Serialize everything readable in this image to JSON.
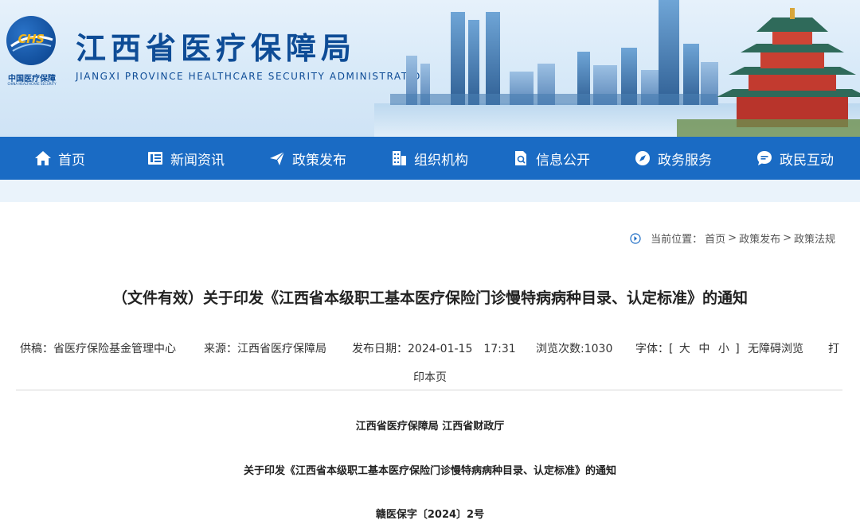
{
  "header": {
    "logo_mark": "CHS",
    "logo_cn": "中国医疗保障",
    "logo_en": "CHINA HEALTHCARE SECURITY",
    "title": "江西省医疗保障局",
    "subtitle": "JIANGXI PROVINCE HEALTHCARE SECURITY ADMINISTRATION"
  },
  "nav": {
    "items": [
      {
        "label": "首页",
        "icon": "home-icon"
      },
      {
        "label": "新闻资讯",
        "icon": "news-icon"
      },
      {
        "label": "政策发布",
        "icon": "paper-plane-icon"
      },
      {
        "label": "组织机构",
        "icon": "building-icon"
      },
      {
        "label": "信息公开",
        "icon": "document-search-icon"
      },
      {
        "label": "政务服务",
        "icon": "compass-icon"
      },
      {
        "label": "政民互动",
        "icon": "chat-icon"
      }
    ]
  },
  "breadcrumb": {
    "prefix": "当前位置：",
    "items": [
      "首页",
      "政策发布",
      "政策法规"
    ],
    "separator": ">"
  },
  "article": {
    "title": "（文件有效）关于印发《江西省本级职工基本医疗保险门诊慢特病病种目录、认定标准》的通知",
    "meta": {
      "contributor": "供稿：省医疗保险基金管理中心",
      "source": "来源：江西省医疗保障局",
      "date": "发布日期：2024-01-15　17:31",
      "views": "浏览次数:1030",
      "font_label": "字体：[",
      "font_large": "大",
      "font_medium": "中",
      "font_small": "小",
      "font_end": "]",
      "accessible": "无障碍浏览",
      "print_a": "打",
      "print_b": "印本页"
    },
    "issuer": "江西省医疗保障局  江西省财政厅",
    "doc_title": "关于印发《江西省本级职工基本医疗保险门诊慢特病病种目录、认定标准》的通知",
    "doc_number": "赣医保字〔2024〕2号"
  },
  "colors": {
    "brand_blue": "#0e4c96",
    "nav_blue": "#1a6bc4",
    "logo_gold": "#f2b51a"
  }
}
